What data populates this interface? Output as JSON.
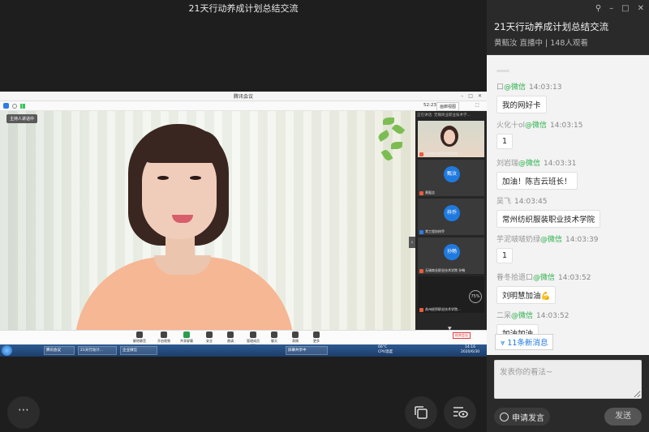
{
  "stream": {
    "title": "21天行动养成计划总结交流"
  },
  "meeting_window": {
    "title": "腾讯会议",
    "time": "52:23",
    "gallery_label": "画廊视图",
    "speaker_tag": "主持人讲话中",
    "sidebar_header": "正在讲话: 无锡商业职业技术学...",
    "thumbs": [
      {
        "avatar": "",
        "label": "无锡商业职业技术学院..."
      },
      {
        "avatar": "甄汝",
        "label": "黄甄汝"
      },
      {
        "avatar": "梓乔",
        "label": "常工程纺梓乔"
      },
      {
        "avatar": "孙畅",
        "label": "无锡商业职业技术学院 孙畅"
      },
      {
        "avatar": "",
        "label": "苏州经贸职业技术学院..."
      }
    ],
    "progress_pct": "75%",
    "toolbar": [
      "解除静音",
      "开启视频",
      "共享屏幕",
      "安全",
      "邀请",
      "管理成员(23)",
      "聊天",
      "表情",
      "更多"
    ],
    "end_hint": "结束会议",
    "taskbar": {
      "tasks": [
        "腾讯会议",
        "21天行动计...",
        "企业微信",
        "屏幕共享中"
      ],
      "temp": "66°C",
      "cpu": "CPU温度",
      "clock_time": "14:16",
      "clock_date": "2020/6/30"
    }
  },
  "panel": {
    "title": "21天行动养成计划总结交流",
    "subtitle": "黄甄汝 直播中 | 148人观看",
    "window_controls": [
      "pin-icon",
      "minimize-icon",
      "maximize-icon",
      "close-icon"
    ]
  },
  "chat": {
    "messages": [
      {
        "name": "口",
        "source": "@微信",
        "time": "14:03:13",
        "text": "我的网好卡"
      },
      {
        "name": "火化十ol",
        "source": "@微信",
        "time": "14:03:15",
        "text": "1"
      },
      {
        "name": "刘岩瑞",
        "source": "@微信",
        "time": "14:03:31",
        "text": "加油！陈吉云班长！"
      },
      {
        "name": "吴飞",
        "source": "",
        "time": "14:03:45",
        "text": "常州纺织服装职业技术学院"
      },
      {
        "name": "芋泥啵啵奶绿",
        "source": "@微信",
        "time": "14:03:39",
        "text": "1"
      },
      {
        "name": "眷冬拾遗口",
        "source": "@微信",
        "time": "14:03:52",
        "text": "刘明慧加油💪"
      },
      {
        "name": "二呆",
        "source": "@微信",
        "time": "14:03:52",
        "text": "加油加油"
      }
    ],
    "new_messages": "11条新消息",
    "input_placeholder": "发表你的看法~",
    "apply_label": "申请发言",
    "send_label": "发送"
  },
  "controls": {
    "more_icon": "more-icon",
    "switch_icon": "switch-window-icon",
    "eye_icon": "view-mode-icon"
  },
  "colors": {
    "accent": "#1f7ae0",
    "wechat_green": "#2db04c"
  }
}
